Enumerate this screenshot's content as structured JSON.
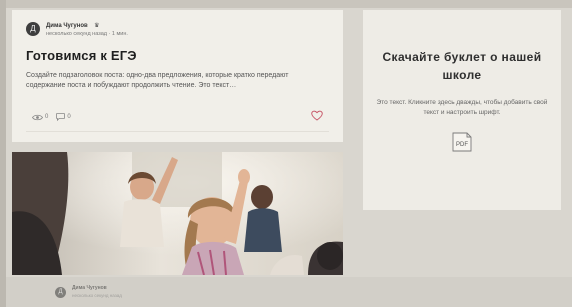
{
  "post": {
    "author_name": "Дима Чугунов",
    "author_initial": "Д",
    "time": "несколько секунд назад · 1 мин.",
    "title": "Готовимся к ЕГЭ",
    "excerpt": "Создайте подзаголовок поста: одно-два предложения, которые кратко передают содержание поста и побуждают продолжить чтение. Это текст…",
    "views": "0",
    "comments": "0"
  },
  "booklet": {
    "title": "Скачайте буклет о нашей школе",
    "text": "Это текст. Кликните здесь дважды, чтобы добавить свой текст и настроить шрифт.",
    "icon_label": "PDF"
  },
  "second_post": {
    "author_name": "Дима Чугунов",
    "author_initial": "Д",
    "time": "несколько секунд назад"
  },
  "colors": {
    "card_bg": "#f1efe9",
    "heart": "#c8596a",
    "page_bg": "#d9d6cf"
  },
  "icons": {
    "views": "eye-icon",
    "comments": "comment-icon",
    "like": "heart-icon",
    "pdf": "pdf-file-icon"
  }
}
